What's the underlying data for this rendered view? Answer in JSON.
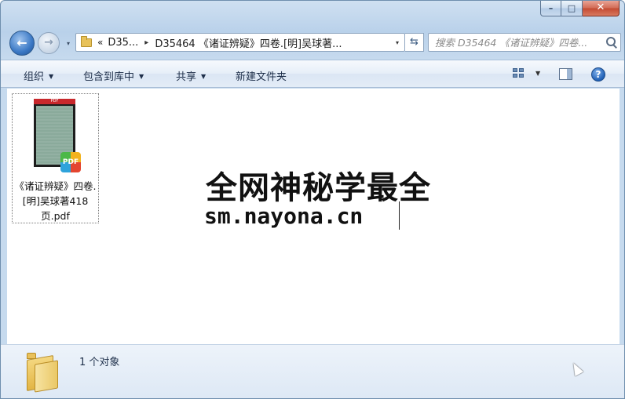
{
  "window": {
    "caption": {
      "minimize": "–",
      "maximize": "□",
      "close": "✕"
    }
  },
  "nav": {
    "back_arrow": "←",
    "forward_arrow": "→",
    "history_dropdown": "▾"
  },
  "address": {
    "chevron": "«",
    "crumbs": [
      "D35...",
      "D35464 《诸证辨疑》四卷.[明]吴球著..."
    ],
    "separator": "▸",
    "dropdown": "▾",
    "refresh": "⇆"
  },
  "search": {
    "placeholder": "搜索 D35464 《诸证辨疑》四卷..."
  },
  "toolbar": {
    "organize": "组织",
    "include_in_library": "包含到库中",
    "share": "共享",
    "new_folder": "新建文件夹",
    "dropdown_glyph": "▼",
    "help": "?"
  },
  "files": [
    {
      "name": "《诸证辨疑》四卷.[明]吴球著418页.pdf",
      "thumb_header": "PDF",
      "badge": "PDF",
      "icon": "pdf-file-icon"
    }
  ],
  "watermark": {
    "line1": "全网神秘学最全",
    "line2": "sm.nayona.cn"
  },
  "details": {
    "count": "1 个对象",
    "icon": "folder-icon"
  },
  "colors": {
    "frame": "#b9d1ea",
    "close_button": "#c34a32",
    "pdf_header": "#c8282c"
  }
}
